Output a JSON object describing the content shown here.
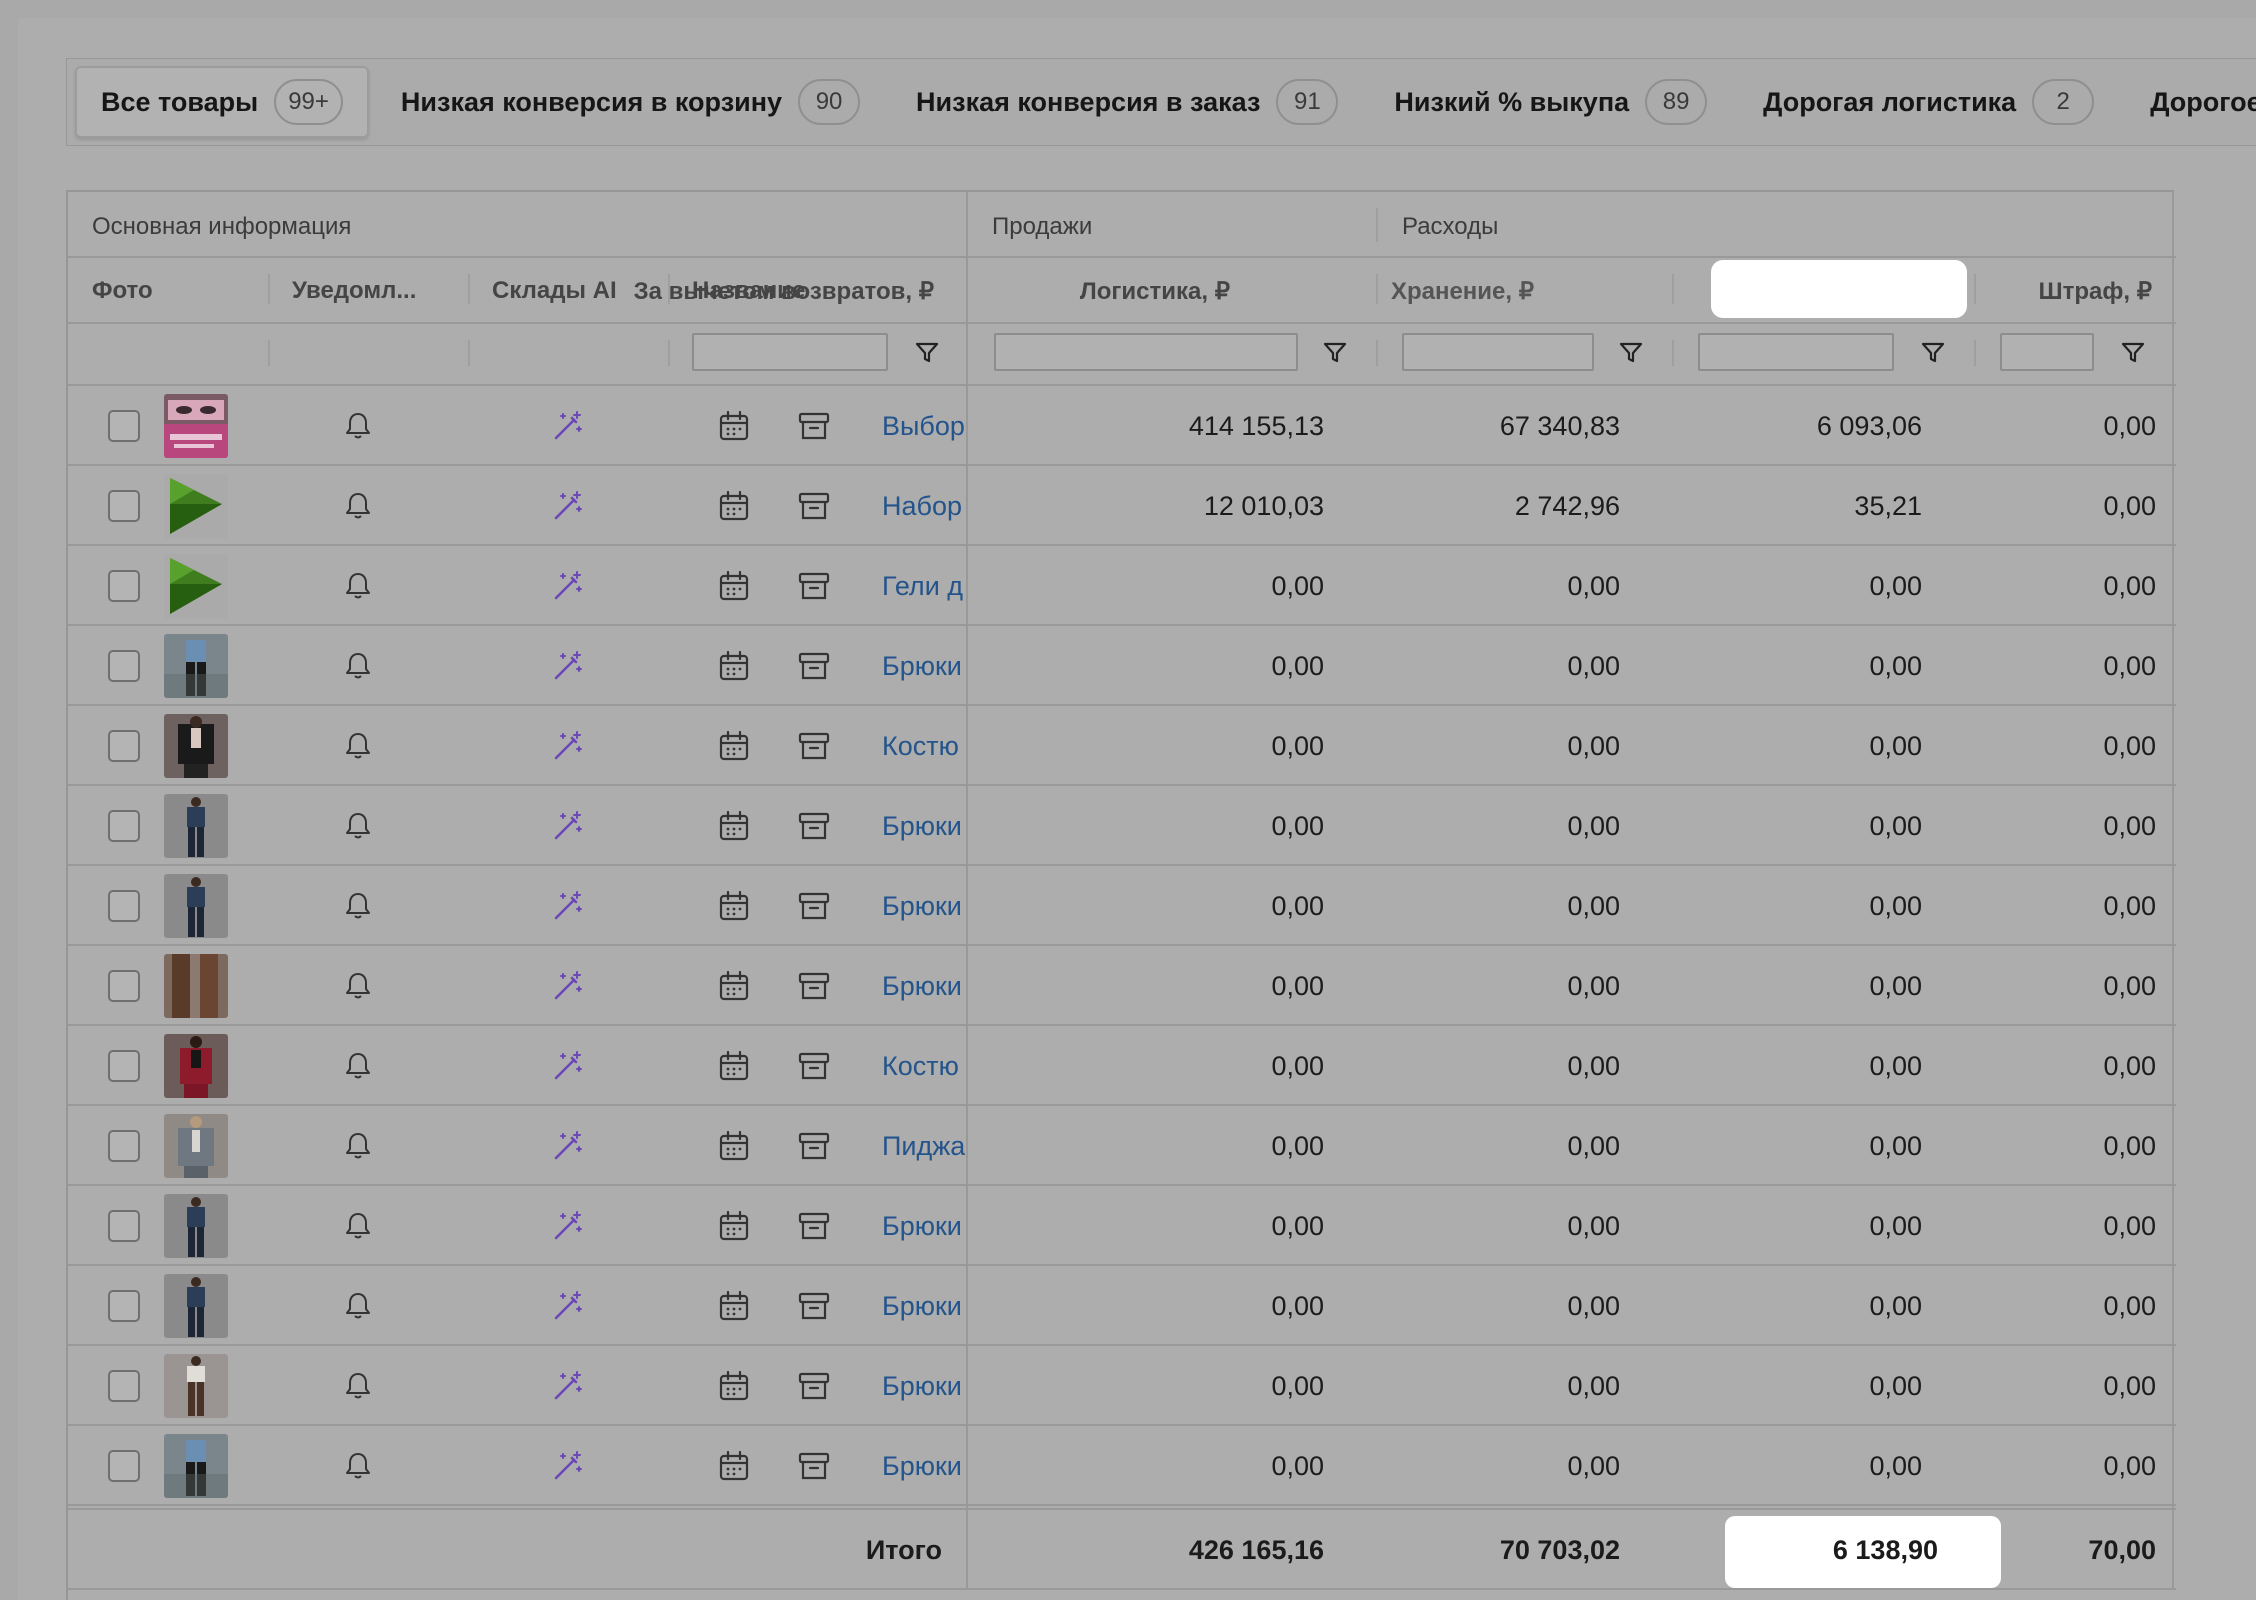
{
  "tabs": [
    {
      "label": "Все товары",
      "count": "99+"
    },
    {
      "label": "Низкая конверсия в корзину",
      "count": "90"
    },
    {
      "label": "Низкая конверсия в заказ",
      "count": "91"
    },
    {
      "label": "Низкий % выкупа",
      "count": "89"
    },
    {
      "label": "Дорогая логистика",
      "count": "2"
    },
    {
      "label": "Дорогое"
    }
  ],
  "table": {
    "groups": {
      "basic": "Основная информация",
      "sales": "Продажи",
      "expenses": "Расходы"
    },
    "columns": {
      "photo": "Фото",
      "notify": "Уведомл...",
      "ai": "Склады AI",
      "name": "Название",
      "net": "За вычетом возвратов, ₽",
      "logistics": "Логистика, ₽",
      "storage": "Хранение, ₽",
      "fine": "Штраф, ₽"
    },
    "rows": [
      {
        "thumb": "pink-product",
        "name": "Выбор",
        "net": "414 155,13",
        "logistics": "67 340,83",
        "storage": "6 093,06",
        "fine": "0,00"
      },
      {
        "thumb": "green-logo",
        "name": "Набор",
        "net": "12 010,03",
        "logistics": "2 742,96",
        "storage": "35,21",
        "fine": "0,00"
      },
      {
        "thumb": "green-logo",
        "name": "Гели д",
        "net": "0,00",
        "logistics": "0,00",
        "storage": "0,00",
        "fine": "0,00"
      },
      {
        "thumb": "blue-top-black-pants",
        "name": "Брюки",
        "net": "0,00",
        "logistics": "0,00",
        "storage": "0,00",
        "fine": "0,00"
      },
      {
        "thumb": "black-suit",
        "name": "Костю",
        "net": "0,00",
        "logistics": "0,00",
        "storage": "0,00",
        "fine": "0,00"
      },
      {
        "thumb": "navy-outfit",
        "name": "Брюки",
        "net": "0,00",
        "logistics": "0,00",
        "storage": "0,00",
        "fine": "0,00"
      },
      {
        "thumb": "navy-outfit",
        "name": "Брюки",
        "net": "0,00",
        "logistics": "0,00",
        "storage": "0,00",
        "fine": "0,00"
      },
      {
        "thumb": "brown-pants",
        "name": "Брюки",
        "net": "0,00",
        "logistics": "0,00",
        "storage": "0,00",
        "fine": "0,00"
      },
      {
        "thumb": "red-suit",
        "name": "Костю",
        "net": "0,00",
        "logistics": "0,00",
        "storage": "0,00",
        "fine": "0,00"
      },
      {
        "thumb": "grey-blazer",
        "name": "Пиджа",
        "net": "0,00",
        "logistics": "0,00",
        "storage": "0,00",
        "fine": "0,00"
      },
      {
        "thumb": "navy-outfit",
        "name": "Брюки",
        "net": "0,00",
        "logistics": "0,00",
        "storage": "0,00",
        "fine": "0,00"
      },
      {
        "thumb": "navy-outfit",
        "name": "Брюки",
        "net": "0,00",
        "logistics": "0,00",
        "storage": "0,00",
        "fine": "0,00"
      },
      {
        "thumb": "white-top-brown-pants",
        "name": "Брюки",
        "net": "0,00",
        "logistics": "0,00",
        "storage": "0,00",
        "fine": "0,00"
      },
      {
        "thumb": "blue-top-black-pants",
        "name": "Брюки",
        "net": "0,00",
        "logistics": "0,00",
        "storage": "0,00",
        "fine": "0,00"
      }
    ],
    "totals": {
      "label": "Итого",
      "net": "426 165,16",
      "logistics": "70 703,02",
      "storage": "6 138,90",
      "fine": "70,00"
    }
  },
  "colors": {
    "link": "#24548c",
    "ai_icon": "#6b47b8",
    "highlight": "#ffffff",
    "overlay": "#adadad"
  },
  "icons": {
    "notify": "bell-icon",
    "ai": "magic-wand-icon",
    "calendar": "calendar-icon",
    "archive": "archive-icon",
    "filter": "filter-icon"
  }
}
